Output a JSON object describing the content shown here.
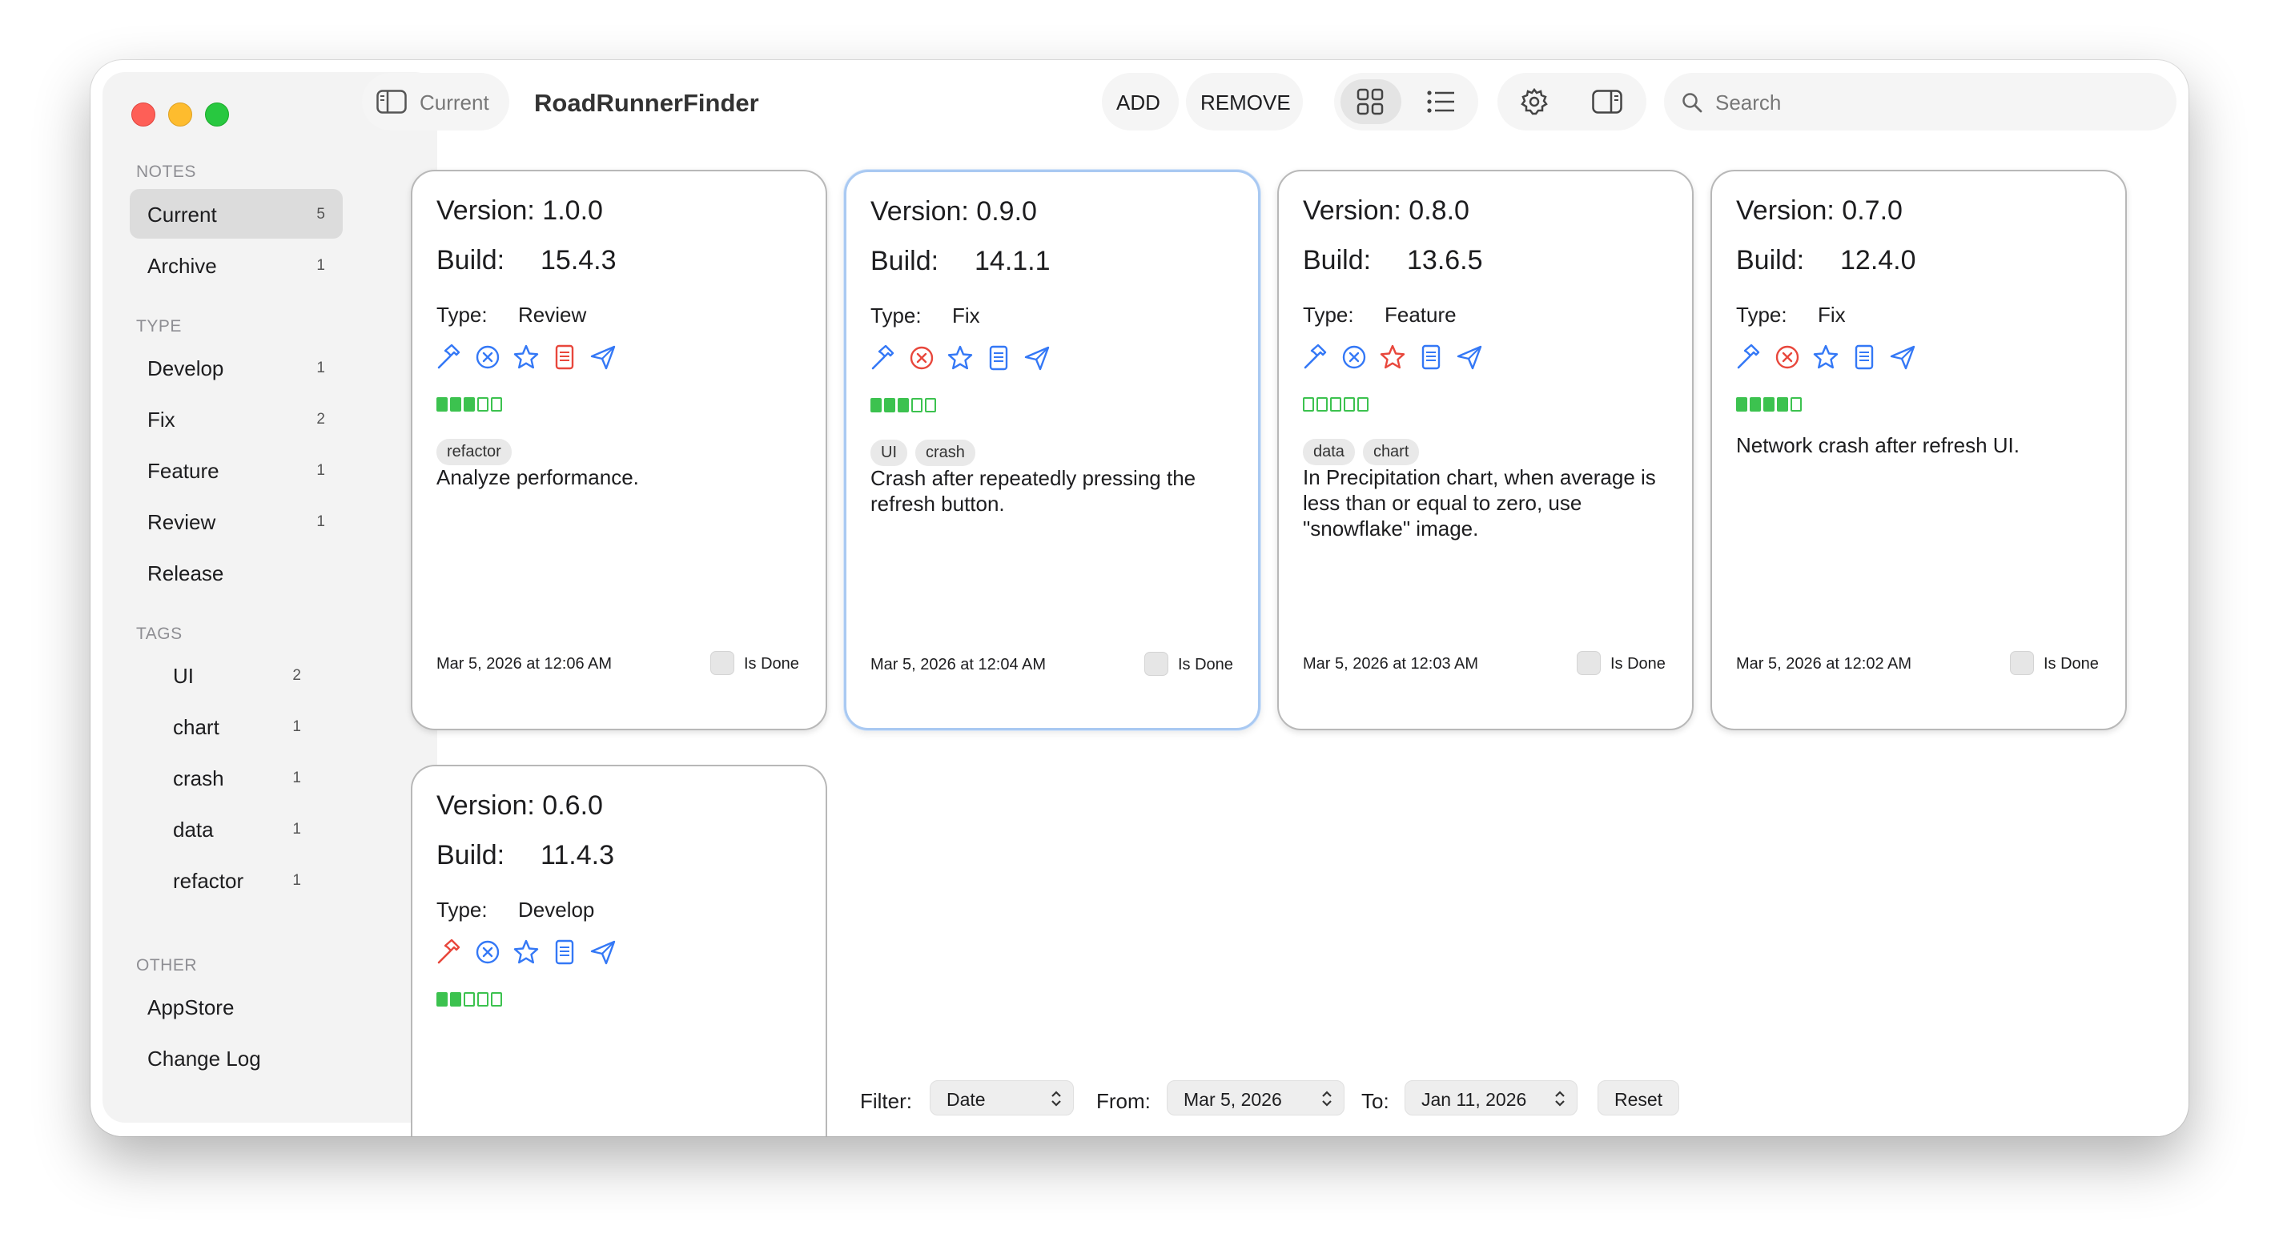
{
  "app": {
    "title": "RoadRunnerFinder",
    "current_label": "Current"
  },
  "toolbar": {
    "add_label": "ADD",
    "remove_label": "REMOVE",
    "search_placeholder": "Search"
  },
  "sidebar": {
    "notes_title": "NOTES",
    "notes": [
      {
        "label": "Current",
        "count": "5",
        "selected": true
      },
      {
        "label": "Archive",
        "count": "1"
      }
    ],
    "type_title": "TYPE",
    "types": [
      {
        "label": "Develop",
        "count": "1"
      },
      {
        "label": "Fix",
        "count": "2"
      },
      {
        "label": "Feature",
        "count": "1"
      },
      {
        "label": "Review",
        "count": "1"
      },
      {
        "label": "Release",
        "count": ""
      }
    ],
    "tags_title": "TAGS",
    "tags": [
      {
        "label": "UI",
        "count": "2"
      },
      {
        "label": "chart",
        "count": "1"
      },
      {
        "label": "crash",
        "count": "1"
      },
      {
        "label": "data",
        "count": "1"
      },
      {
        "label": "refactor",
        "count": "1"
      }
    ],
    "other_title": "OTHER",
    "other": [
      {
        "label": "AppStore"
      },
      {
        "label": "Change Log"
      }
    ]
  },
  "card_labels": {
    "build": "Build:",
    "type": "Type:",
    "is_done": "Is Done"
  },
  "cards": [
    {
      "version": "Version: 1.0.0",
      "build": "15.4.3",
      "type": "Review",
      "icons": [
        "hammer-icon",
        "xmark-circle-icon",
        "star-icon",
        "document-icon",
        "paper-plane-icon"
      ],
      "icon_colors": [
        "#3478f6",
        "#3478f6",
        "#3478f6",
        "#e8473c",
        "#3478f6"
      ],
      "progress": 3,
      "tags": [
        "refactor"
      ],
      "text": "Analyze performance.",
      "date": "Mar 5, 2026 at 12:06 AM"
    },
    {
      "version": "Version: 0.9.0",
      "build": "14.1.1",
      "type": "Fix",
      "icons": [
        "hammer-icon",
        "xmark-circle-icon",
        "star-icon",
        "document-icon",
        "paper-plane-icon"
      ],
      "icon_colors": [
        "#3478f6",
        "#e8473c",
        "#3478f6",
        "#3478f6",
        "#3478f6"
      ],
      "progress": 3,
      "tags": [
        "UI",
        "crash"
      ],
      "text": "Crash after repeatedly pressing the refresh button.",
      "date": "Mar 5, 2026 at 12:04 AM",
      "selected": true
    },
    {
      "version": "Version: 0.8.0",
      "build": "13.6.5",
      "type": "Feature",
      "icons": [
        "hammer-icon",
        "xmark-circle-icon",
        "star-icon",
        "document-icon",
        "paper-plane-icon"
      ],
      "icon_colors": [
        "#3478f6",
        "#3478f6",
        "#e8473c",
        "#3478f6",
        "#3478f6"
      ],
      "progress": 0,
      "tags": [
        "data",
        "chart"
      ],
      "text": "In Precipitation chart, when average is less than or equal to zero, use \"snowflake\" image.",
      "date": "Mar 5, 2026 at 12:03 AM"
    },
    {
      "version": "Version: 0.7.0",
      "build": "12.4.0",
      "type": "Fix",
      "icons": [
        "hammer-icon",
        "xmark-circle-icon",
        "star-icon",
        "document-icon",
        "paper-plane-icon"
      ],
      "icon_colors": [
        "#3478f6",
        "#e8473c",
        "#3478f6",
        "#3478f6",
        "#3478f6"
      ],
      "progress": 4,
      "tags": [],
      "text": "Network crash after refresh UI.",
      "date": "Mar 5, 2026 at 12:02 AM"
    },
    {
      "version": "Version: 0.6.0",
      "build": "11.4.3",
      "type": "Develop",
      "icons": [
        "hammer-icon",
        "xmark-circle-icon",
        "star-icon",
        "document-icon",
        "paper-plane-icon"
      ],
      "icon_colors": [
        "#e8473c",
        "#3478f6",
        "#3478f6",
        "#3478f6",
        "#3478f6"
      ],
      "progress": 2,
      "tags": [],
      "text": "",
      "date": ""
    }
  ],
  "filter": {
    "filter_label": "Filter:",
    "filter_value": "Date",
    "from_label": "From:",
    "from_value": "Mar 5, 2026",
    "to_label": "To:",
    "to_value": "Jan 11, 2026",
    "reset_label": "Reset"
  },
  "colors": {
    "accent": "#3478f6",
    "alert": "#e8473c",
    "progress": "#3cc24f"
  }
}
